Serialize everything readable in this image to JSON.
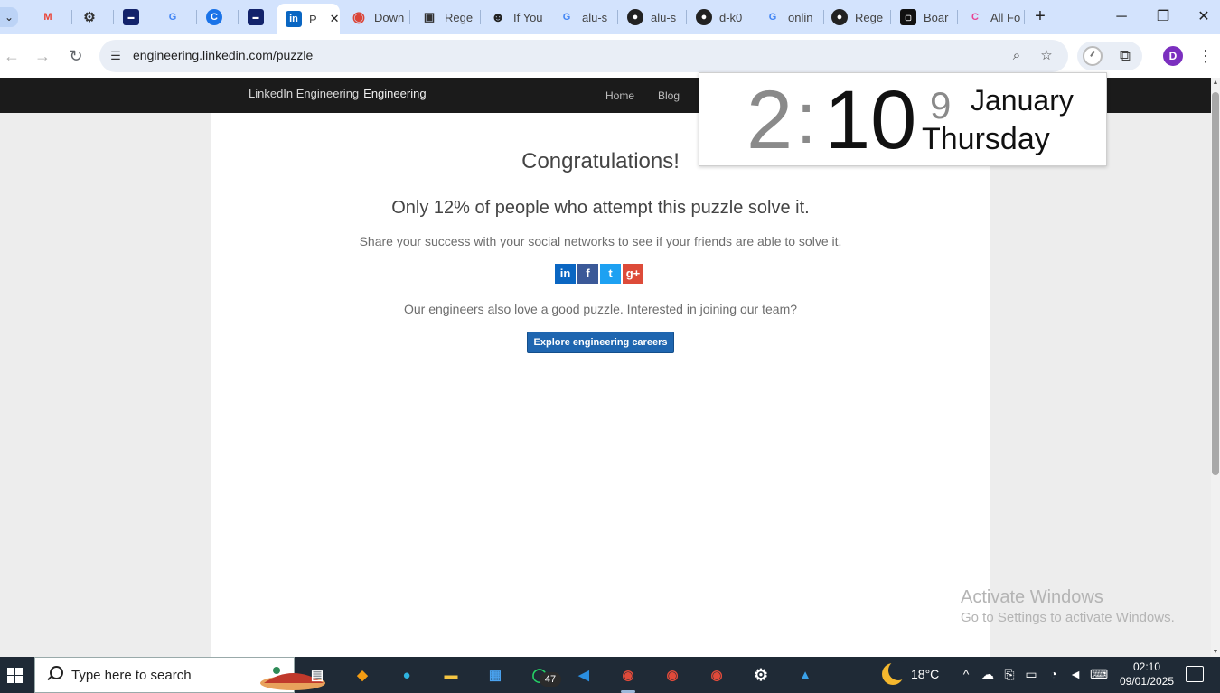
{
  "browser": {
    "tabs": [
      {
        "title": "",
        "favicon": "gmail-icon"
      },
      {
        "title": "",
        "favicon": "chatgpt-icon"
      },
      {
        "title": "",
        "favicon": "site-icon"
      },
      {
        "title": "",
        "favicon": "google-icon"
      },
      {
        "title": "",
        "favicon": "c-icon"
      },
      {
        "title": "",
        "favicon": "site-icon"
      },
      {
        "title": "P",
        "favicon": "linkedin-icon",
        "active": true
      },
      {
        "title": "Down",
        "favicon": "chrome-icon"
      },
      {
        "title": "Rege",
        "favicon": "regex-icon"
      },
      {
        "title": "If You",
        "favicon": "avatar-icon"
      },
      {
        "title": "alu-s",
        "favicon": "google-icon"
      },
      {
        "title": "alu-s",
        "favicon": "github-icon"
      },
      {
        "title": "d-k0",
        "favicon": "github-icon"
      },
      {
        "title": "onlin",
        "favicon": "google-icon"
      },
      {
        "title": "Rege",
        "favicon": "github-icon"
      },
      {
        "title": "Boar",
        "favicon": "board-icon"
      },
      {
        "title": "All Fo",
        "favicon": "allfor-icon"
      }
    ],
    "url": "engineering.linkedin.com/puzzle",
    "profile_initial": "D",
    "window_controls": {
      "minimize": "─",
      "restore": "❐",
      "close": "✕"
    }
  },
  "site": {
    "brand_alt": "LinkedIn Engineering",
    "brand_name": "Engineering",
    "nav": [
      "Home",
      "Blog"
    ]
  },
  "content": {
    "title": "Congratulations!",
    "stat": "Only 12% of people who attempt this puzzle solve it.",
    "share_text": "Share your success with your social networks to see if your friends are able to solve it.",
    "social": [
      {
        "name": "linkedin",
        "glyph": "in",
        "color": "#0a66c2"
      },
      {
        "name": "facebook",
        "glyph": "f",
        "color": "#3b5998"
      },
      {
        "name": "twitter",
        "glyph": "t",
        "color": "#1da1f2"
      },
      {
        "name": "google-plus",
        "glyph": "g+",
        "color": "#dd4b39"
      }
    ],
    "join_text": "Our engineers also love a good puzzle. Interested in joining our team?",
    "cta_label": "Explore engineering careers"
  },
  "clock_widget": {
    "hour": "2",
    "colon": ":",
    "minute": "10",
    "day": "9",
    "month": "January",
    "weekday": "Thursday"
  },
  "watermark": {
    "title": "Activate Windows",
    "subtitle": "Go to Settings to activate Windows."
  },
  "taskbar": {
    "search_placeholder": "Type here to search",
    "whatsapp_badge": "47",
    "temperature": "18°C",
    "time": "02:10",
    "date": "09/01/2025"
  }
}
